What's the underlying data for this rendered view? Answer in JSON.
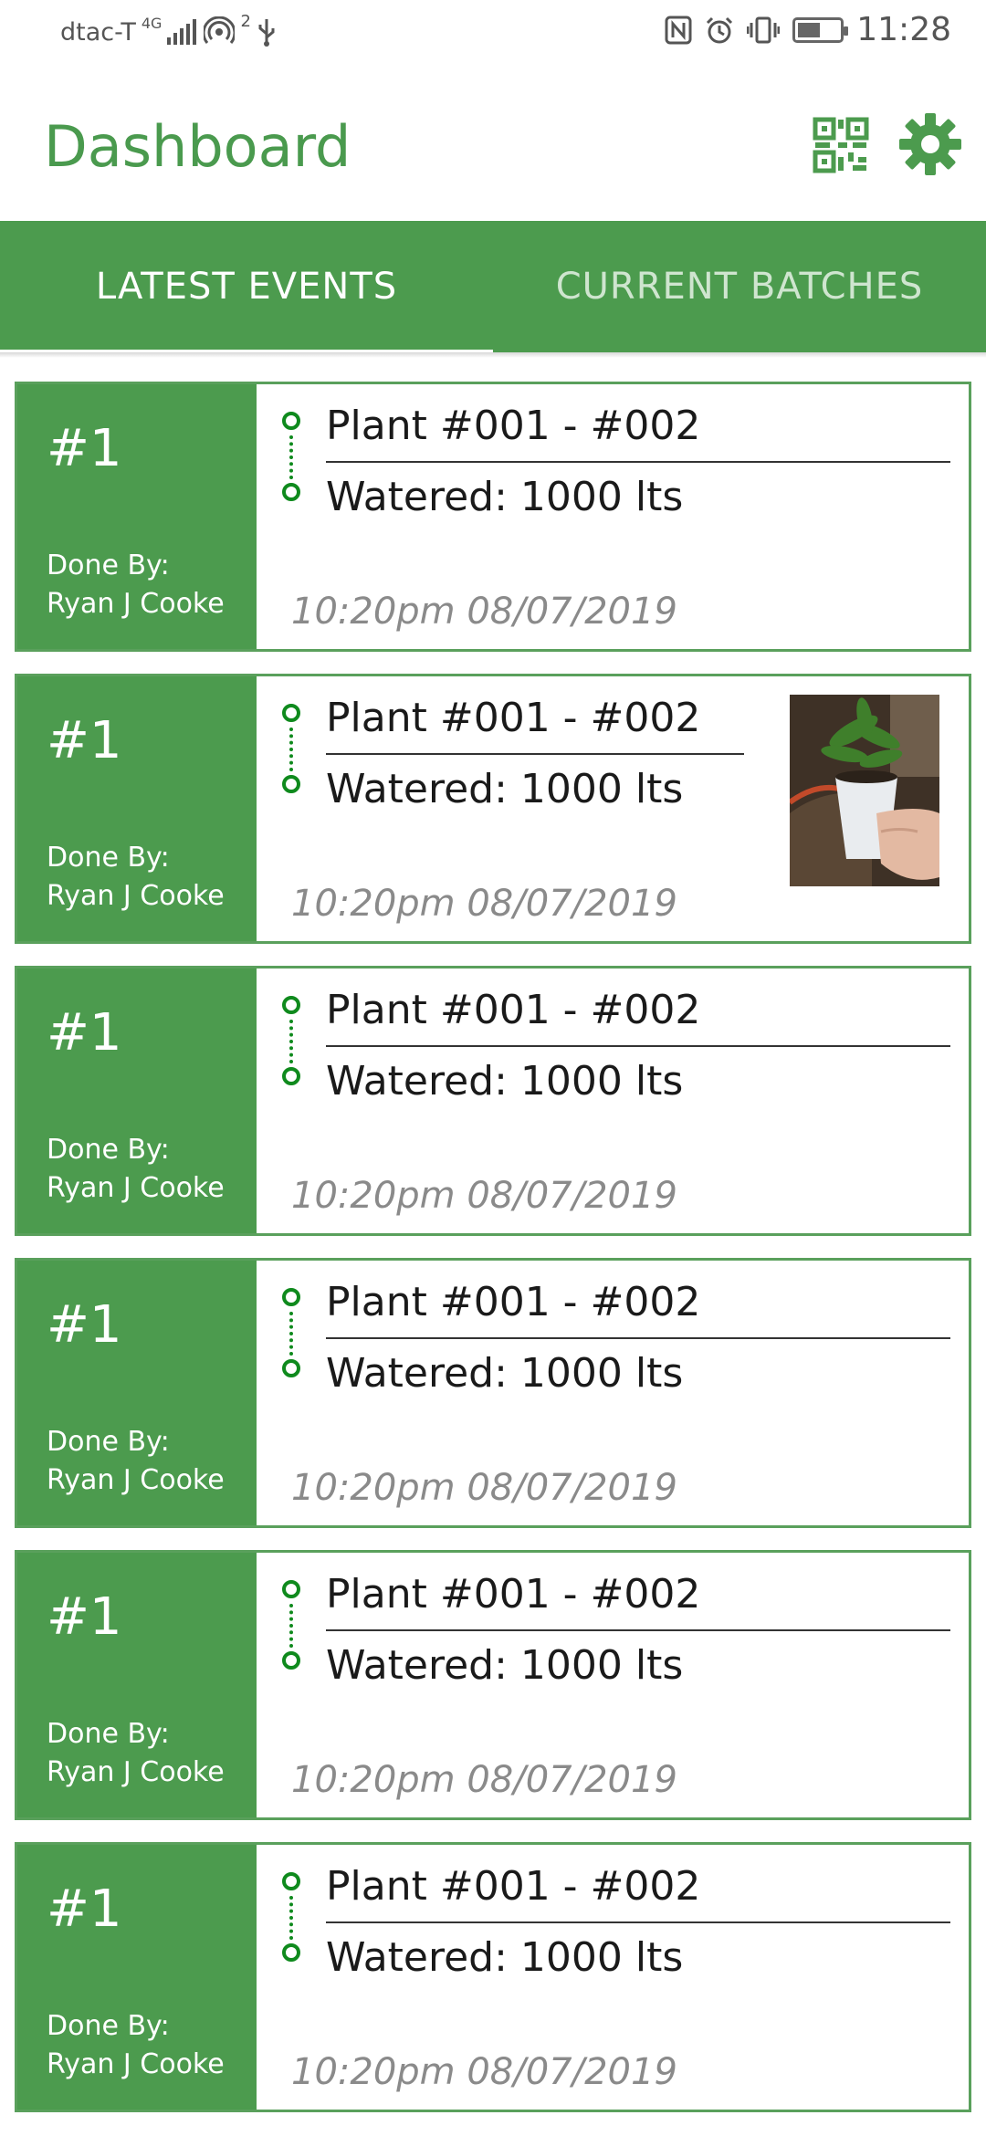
{
  "status_bar": {
    "carrier": "dtac-T",
    "network": "4G",
    "notification_count": "2",
    "time": "11:28",
    "icons": [
      "signal-icon",
      "hotspot-icon",
      "usb-icon",
      "nfc-icon",
      "alarm-icon",
      "vibrate-icon",
      "battery-charging-icon"
    ]
  },
  "app_bar": {
    "title": "Dashboard",
    "icons": [
      "qr-code-icon",
      "settings-gear-icon"
    ]
  },
  "tabs": [
    {
      "label": "LATEST EVENTS",
      "active": true
    },
    {
      "label": "CURRENT BATCHES",
      "active": false
    }
  ],
  "colors": {
    "primary": "#4c9b4e",
    "timeline": "#0f8a1d",
    "timestamp": "#8a8a8a"
  },
  "events": [
    {
      "number": "#1",
      "done_by_label": "Done By:",
      "done_by_name": "Ryan J Cooke",
      "plant": "Plant #001 - #002",
      "action": "Watered: 1000 lts",
      "timestamp": "10:20pm 08/07/2019",
      "has_photo": false
    },
    {
      "number": "#1",
      "done_by_label": "Done By:",
      "done_by_name": "Ryan J Cooke",
      "plant": "Plant #001 - #002",
      "action": "Watered: 1000 lts",
      "timestamp": "10:20pm 08/07/2019",
      "has_photo": true
    },
    {
      "number": "#1",
      "done_by_label": "Done By:",
      "done_by_name": "Ryan J Cooke",
      "plant": "Plant #001 - #002",
      "action": "Watered: 1000 lts",
      "timestamp": "10:20pm 08/07/2019",
      "has_photo": false
    },
    {
      "number": "#1",
      "done_by_label": "Done By:",
      "done_by_name": "Ryan J Cooke",
      "plant": "Plant #001 - #002",
      "action": "Watered: 1000 lts",
      "timestamp": "10:20pm 08/07/2019",
      "has_photo": false
    },
    {
      "number": "#1",
      "done_by_label": "Done By:",
      "done_by_name": "Ryan J Cooke",
      "plant": "Plant #001 - #002",
      "action": "Watered: 1000 lts",
      "timestamp": "10:20pm 08/07/2019",
      "has_photo": false
    },
    {
      "number": "#1",
      "done_by_label": "Done By:",
      "done_by_name": "Ryan J Cooke",
      "plant": "Plant #001 - #002",
      "action": "Watered: 1000 lts",
      "timestamp": "10:20pm 08/07/2019",
      "has_photo": false
    }
  ]
}
